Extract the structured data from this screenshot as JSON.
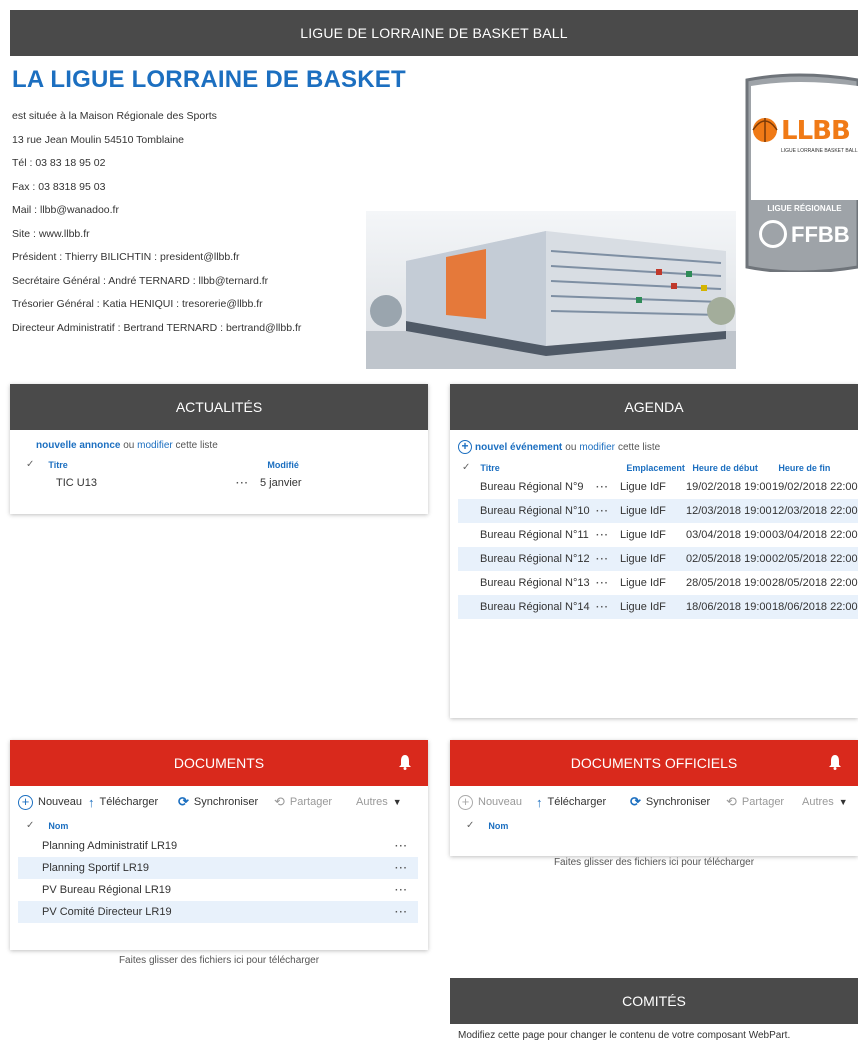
{
  "header": {
    "site_title": "LIGUE DE LORRAINE DE BASKET BALL"
  },
  "intro": {
    "title": "LA LIGUE LORRAINE DE BASKET",
    "lines": [
      "est située à la Maison Régionale des Sports",
      "13 rue Jean Moulin 54510 Tomblaine",
      "Tél : 03 83 18 95 02",
      "Fax : 03 8318 95 03",
      "Mail : llbb@wanadoo.fr",
      "Site : www.llbb.fr",
      "Président : Thierry BILICHTIN : president@llbb.fr",
      "Secrétaire Général : André TERNARD : llbb@ternard.fr",
      "Trésorier Général : Katia HENIQUI : tresorerie@llbb.fr",
      "Directeur Administratif : Bertrand TERNARD : bertrand@llbb.fr"
    ]
  },
  "logo": {
    "brand": "LLBB",
    "subtitle": "LIGUE LORRAINE BASKET BALL",
    "region": "LIGUE RÉGIONALE",
    "federation": "FFBB"
  },
  "actualites": {
    "title": "ACTUALITÉS",
    "new_link": "nouvelle annonce",
    "or": "ou",
    "modify_link": "modifier",
    "suffix": "cette liste",
    "columns": {
      "titre": "Titre",
      "modifie": "Modifié"
    },
    "items": [
      {
        "titre": "TIC U13",
        "modifie": "5 janvier"
      }
    ]
  },
  "agenda": {
    "title": "AGENDA",
    "new_link": "nouvel événement",
    "or": "ou",
    "modify_link": "modifier",
    "suffix": "cette liste",
    "columns": {
      "titre": "Titre",
      "emplacement": "Emplacement",
      "debut": "Heure de début",
      "fin": "Heure de fin"
    },
    "items": [
      {
        "titre": "Bureau Régional N°9",
        "emplacement": "Ligue IdF",
        "debut": "19/02/2018 19:00",
        "fin": "19/02/2018 22:00"
      },
      {
        "titre": "Bureau Régional N°10",
        "emplacement": "Ligue IdF",
        "debut": "12/03/2018 19:00",
        "fin": "12/03/2018 22:00"
      },
      {
        "titre": "Bureau Régional N°11",
        "emplacement": "Ligue IdF",
        "debut": "03/04/2018 19:00",
        "fin": "03/04/2018 22:00"
      },
      {
        "titre": "Bureau Régional N°12",
        "emplacement": "Ligue IdF",
        "debut": "02/05/2018 19:00",
        "fin": "02/05/2018 22:00"
      },
      {
        "titre": "Bureau Régional N°13",
        "emplacement": "Ligue IdF",
        "debut": "28/05/2018 19:00",
        "fin": "28/05/2018 22:00"
      },
      {
        "titre": "Bureau Régional N°14",
        "emplacement": "Ligue IdF",
        "debut": "18/06/2018 19:00",
        "fin": "18/06/2018 22:00"
      }
    ]
  },
  "toolbar": {
    "nouveau": "Nouveau",
    "telecharger": "Télécharger",
    "synchroniser": "Synchroniser",
    "partager": "Partager",
    "autres": "Autres"
  },
  "documents": {
    "title": "DOCUMENTS",
    "column_nom": "Nom",
    "items": [
      "Planning Administratif LR19",
      "Planning Sportif LR19",
      "PV Bureau Régional LR19",
      "PV Comité Directeur LR19"
    ],
    "drop_text": "Faites glisser des fichiers ici pour télécharger"
  },
  "documents_officiels": {
    "title": "DOCUMENTS OFFICIELS",
    "column_nom": "Nom",
    "drop_text": "Faites glisser des fichiers ici pour télécharger"
  },
  "comites": {
    "title": "COMITÉS",
    "message": "Modifiez cette page pour changer le contenu de votre composant WebPart."
  },
  "colors": {
    "accent": "#1c6fc0",
    "header": "#4a4a4a",
    "red": "#d9291c",
    "orange": "#f07a16"
  }
}
